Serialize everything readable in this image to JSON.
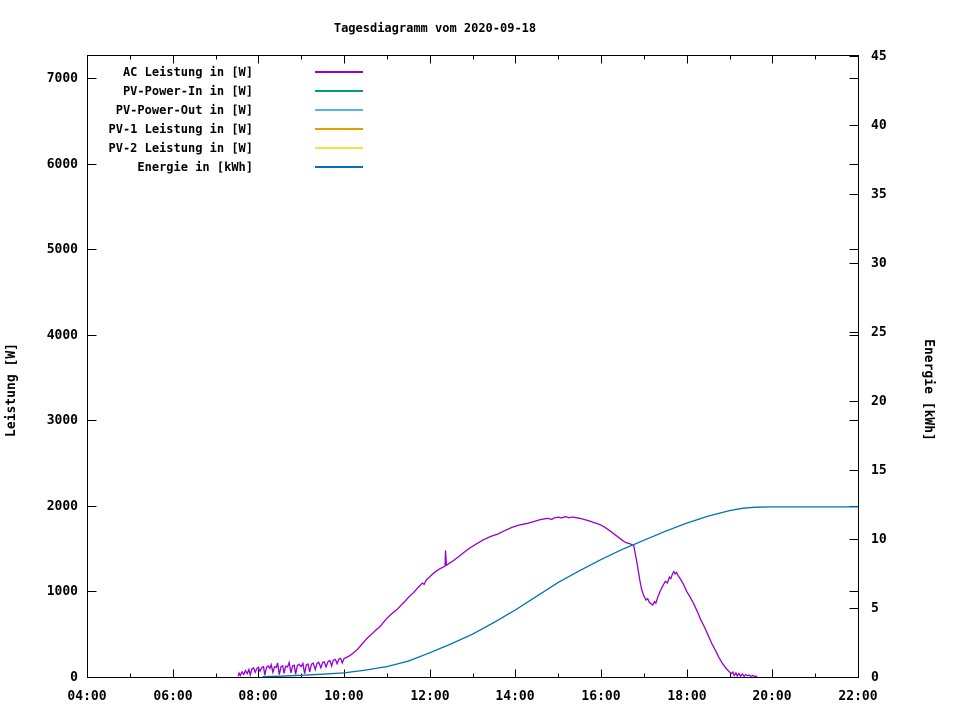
{
  "page": {
    "background": "#ffffff",
    "text_color": "#000000"
  },
  "chart_data": {
    "type": "line",
    "title": "Tagesdiagramm vom 2020-09-18",
    "grid": "off",
    "legend_position": "top-left-inside",
    "x_axis": {
      "label": "",
      "min": 4,
      "max": 22,
      "major_ticks": [
        {
          "v": 4,
          "label": "04:00"
        },
        {
          "v": 6,
          "label": "06:00"
        },
        {
          "v": 8,
          "label": "08:00"
        },
        {
          "v": 10,
          "label": "10:00"
        },
        {
          "v": 12,
          "label": "12:00"
        },
        {
          "v": 14,
          "label": "14:00"
        },
        {
          "v": 16,
          "label": "16:00"
        },
        {
          "v": 18,
          "label": "18:00"
        },
        {
          "v": 20,
          "label": "20:00"
        },
        {
          "v": 22,
          "label": "22:00"
        }
      ],
      "minor_ticks": [
        5,
        7,
        9,
        11,
        13,
        15,
        17,
        19,
        21
      ]
    },
    "y_axis": {
      "label": "Leistung [W]",
      "min": 0,
      "max": 7270,
      "ticks": [
        0,
        1000,
        2000,
        3000,
        4000,
        5000,
        6000,
        7000
      ]
    },
    "y2_axis": {
      "label": "Energie [kWh]",
      "min": 0,
      "max": 45.05,
      "ticks": [
        0,
        5,
        10,
        15,
        20,
        25,
        30,
        35,
        40,
        45
      ]
    },
    "legend": [
      {
        "name": "AC Leistung in [W]",
        "color": "#9400d3"
      },
      {
        "name": "PV-Power-In in [W]",
        "color": "#009e73"
      },
      {
        "name": "PV-Power-Out in [W]",
        "color": "#56b4e9"
      },
      {
        "name": "PV-1 Leistung in [W]",
        "color": "#e69f00"
      },
      {
        "name": "PV-2 Leistung in [W]",
        "color": "#f0e442"
      },
      {
        "name": "Energie in [kWh]",
        "color": "#0072b2"
      }
    ],
    "series": [
      {
        "name": "AC Leistung in [W]",
        "color": "#9400d3",
        "axis": "y1",
        "points": [
          [
            7.53,
            8
          ],
          [
            7.55,
            45
          ],
          [
            7.58,
            18
          ],
          [
            7.62,
            60
          ],
          [
            7.66,
            30
          ],
          [
            7.7,
            75
          ],
          [
            7.74,
            40
          ],
          [
            7.78,
            88
          ],
          [
            7.81,
            25
          ],
          [
            7.85,
            95
          ],
          [
            7.89,
            108
          ],
          [
            7.93,
            55
          ],
          [
            7.97,
            100
          ],
          [
            8.0,
            115
          ],
          [
            8.04,
            68
          ],
          [
            8.08,
            112
          ],
          [
            8.12,
            120
          ],
          [
            8.15,
            22
          ],
          [
            8.19,
            112
          ],
          [
            8.23,
            128
          ],
          [
            8.27,
            100
          ],
          [
            8.3,
            145
          ],
          [
            8.34,
            55
          ],
          [
            8.38,
            120
          ],
          [
            8.42,
            112
          ],
          [
            8.45,
            165
          ],
          [
            8.49,
            28
          ],
          [
            8.53,
            118
          ],
          [
            8.57,
            132
          ],
          [
            8.6,
            42
          ],
          [
            8.64,
            126
          ],
          [
            8.68,
            118
          ],
          [
            8.72,
            170
          ],
          [
            8.76,
            48
          ],
          [
            8.8,
            128
          ],
          [
            8.84,
            138
          ],
          [
            8.87,
            32
          ],
          [
            8.91,
            132
          ],
          [
            8.95,
            148
          ],
          [
            9.0,
            122
          ],
          [
            9.04,
            158
          ],
          [
            9.08,
            38
          ],
          [
            9.12,
            142
          ],
          [
            9.16,
            152
          ],
          [
            9.2,
            58
          ],
          [
            9.24,
            148
          ],
          [
            9.28,
            162
          ],
          [
            9.33,
            88
          ],
          [
            9.37,
            158
          ],
          [
            9.41,
            172
          ],
          [
            9.46,
            108
          ],
          [
            9.5,
            168
          ],
          [
            9.54,
            178
          ],
          [
            9.58,
            118
          ],
          [
            9.63,
            182
          ],
          [
            9.67,
            192
          ],
          [
            9.71,
            128
          ],
          [
            9.75,
            198
          ],
          [
            9.8,
            205
          ],
          [
            9.84,
            155
          ],
          [
            9.88,
            210
          ],
          [
            9.92,
            218
          ],
          [
            9.96,
            165
          ],
          [
            10.0,
            215
          ],
          [
            10.05,
            228
          ],
          [
            10.1,
            240
          ],
          [
            10.17,
            262
          ],
          [
            10.25,
            295
          ],
          [
            10.33,
            330
          ],
          [
            10.42,
            385
          ],
          [
            10.5,
            430
          ],
          [
            10.58,
            472
          ],
          [
            10.67,
            512
          ],
          [
            10.75,
            550
          ],
          [
            10.84,
            588
          ],
          [
            10.92,
            638
          ],
          [
            11.0,
            685
          ],
          [
            11.09,
            728
          ],
          [
            11.17,
            762
          ],
          [
            11.23,
            785
          ],
          [
            11.33,
            838
          ],
          [
            11.42,
            882
          ],
          [
            11.5,
            928
          ],
          [
            11.58,
            968
          ],
          [
            11.62,
            985
          ],
          [
            11.67,
            1012
          ],
          [
            11.75,
            1058
          ],
          [
            11.83,
            1098
          ],
          [
            11.87,
            1082
          ],
          [
            11.92,
            1132
          ],
          [
            12.0,
            1170
          ],
          [
            12.08,
            1208
          ],
          [
            12.17,
            1242
          ],
          [
            12.25,
            1268
          ],
          [
            12.33,
            1288
          ],
          [
            12.36,
            1300
          ],
          [
            12.37,
            1480
          ],
          [
            12.39,
            1305
          ],
          [
            12.46,
            1330
          ],
          [
            12.54,
            1355
          ],
          [
            12.62,
            1385
          ],
          [
            12.71,
            1420
          ],
          [
            12.79,
            1452
          ],
          [
            12.92,
            1502
          ],
          [
            13.08,
            1552
          ],
          [
            13.25,
            1602
          ],
          [
            13.42,
            1642
          ],
          [
            13.58,
            1668
          ],
          [
            13.75,
            1710
          ],
          [
            13.92,
            1748
          ],
          [
            14.08,
            1775
          ],
          [
            14.25,
            1792
          ],
          [
            14.42,
            1815
          ],
          [
            14.58,
            1840
          ],
          [
            14.75,
            1855
          ],
          [
            14.85,
            1842
          ],
          [
            14.92,
            1862
          ],
          [
            15.0,
            1868
          ],
          [
            15.08,
            1858
          ],
          [
            15.17,
            1875
          ],
          [
            15.25,
            1862
          ],
          [
            15.33,
            1870
          ],
          [
            15.42,
            1862
          ],
          [
            15.5,
            1855
          ],
          [
            15.58,
            1845
          ],
          [
            15.67,
            1832
          ],
          [
            15.75,
            1820
          ],
          [
            15.83,
            1806
          ],
          [
            15.92,
            1792
          ],
          [
            16.0,
            1776
          ],
          [
            16.08,
            1752
          ],
          [
            16.17,
            1722
          ],
          [
            16.25,
            1692
          ],
          [
            16.33,
            1662
          ],
          [
            16.42,
            1628
          ],
          [
            16.5,
            1598
          ],
          [
            16.58,
            1572
          ],
          [
            16.67,
            1558
          ],
          [
            16.72,
            1548
          ],
          [
            16.76,
            1540
          ],
          [
            16.79,
            1470
          ],
          [
            16.83,
            1360
          ],
          [
            16.87,
            1240
          ],
          [
            16.91,
            1120
          ],
          [
            16.95,
            1020
          ],
          [
            17.0,
            950
          ],
          [
            17.05,
            900
          ],
          [
            17.09,
            915
          ],
          [
            17.13,
            870
          ],
          [
            17.17,
            855
          ],
          [
            17.21,
            842
          ],
          [
            17.25,
            880
          ],
          [
            17.28,
            862
          ],
          [
            17.33,
            940
          ],
          [
            17.38,
            1000
          ],
          [
            17.44,
            1062
          ],
          [
            17.5,
            1118
          ],
          [
            17.55,
            1100
          ],
          [
            17.6,
            1168
          ],
          [
            17.63,
            1150
          ],
          [
            17.67,
            1205
          ],
          [
            17.7,
            1232
          ],
          [
            17.73,
            1205
          ],
          [
            17.76,
            1222
          ],
          [
            17.8,
            1185
          ],
          [
            17.86,
            1140
          ],
          [
            17.93,
            1078
          ],
          [
            18.0,
            1000
          ],
          [
            18.08,
            935
          ],
          [
            18.17,
            852
          ],
          [
            18.25,
            762
          ],
          [
            18.33,
            668
          ],
          [
            18.42,
            578
          ],
          [
            18.5,
            488
          ],
          [
            18.58,
            398
          ],
          [
            18.67,
            312
          ],
          [
            18.75,
            232
          ],
          [
            18.83,
            162
          ],
          [
            18.92,
            100
          ],
          [
            19.0,
            60
          ],
          [
            19.04,
            38
          ],
          [
            19.08,
            58
          ],
          [
            19.11,
            18
          ],
          [
            19.15,
            48
          ],
          [
            19.18,
            12
          ],
          [
            19.22,
            42
          ],
          [
            19.26,
            10
          ],
          [
            19.3,
            35
          ],
          [
            19.34,
            8
          ],
          [
            19.38,
            28
          ],
          [
            19.42,
            15
          ],
          [
            19.46,
            22
          ],
          [
            19.5,
            8
          ],
          [
            19.55,
            18
          ],
          [
            19.6,
            5
          ],
          [
            19.65,
            12
          ]
        ]
      },
      {
        "name": "PV-Power-In in [W]",
        "color": "#009e73",
        "axis": "y1",
        "points": []
      },
      {
        "name": "PV-Power-Out in [W]",
        "color": "#56b4e9",
        "axis": "y1",
        "points": []
      },
      {
        "name": "PV-1 Leistung in [W]",
        "color": "#e69f00",
        "axis": "y1",
        "points": []
      },
      {
        "name": "PV-2 Leistung in [W]",
        "color": "#f0e442",
        "axis": "y1",
        "points": []
      },
      {
        "name": "Energie in [kWh]",
        "color": "#0072b2",
        "axis": "y2",
        "points": [
          [
            8.1,
            0.02
          ],
          [
            8.5,
            0.06
          ],
          [
            9.0,
            0.12
          ],
          [
            9.5,
            0.2
          ],
          [
            10.0,
            0.3
          ],
          [
            10.5,
            0.5
          ],
          [
            11.0,
            0.75
          ],
          [
            11.5,
            1.15
          ],
          [
            12.0,
            1.75
          ],
          [
            12.5,
            2.4
          ],
          [
            13.0,
            3.1
          ],
          [
            13.5,
            3.95
          ],
          [
            14.0,
            4.85
          ],
          [
            14.5,
            5.85
          ],
          [
            15.0,
            6.85
          ],
          [
            15.5,
            7.7
          ],
          [
            16.0,
            8.5
          ],
          [
            16.5,
            9.25
          ],
          [
            16.75,
            9.57
          ],
          [
            17.0,
            9.9
          ],
          [
            17.5,
            10.55
          ],
          [
            18.0,
            11.15
          ],
          [
            18.5,
            11.65
          ],
          [
            19.0,
            12.05
          ],
          [
            19.3,
            12.22
          ],
          [
            19.6,
            12.3
          ],
          [
            20.0,
            12.32
          ],
          [
            21.0,
            12.32
          ],
          [
            22.0,
            12.32
          ]
        ]
      }
    ]
  }
}
